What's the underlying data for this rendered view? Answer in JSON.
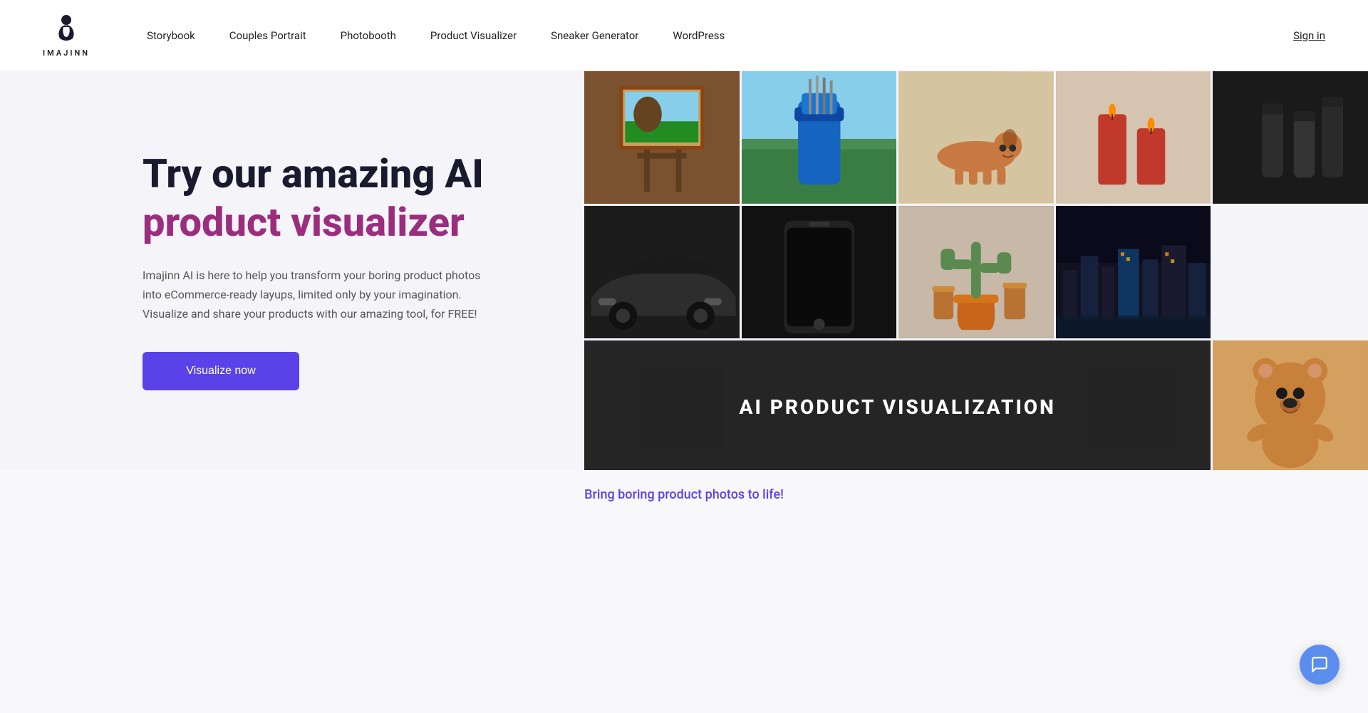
{
  "header": {
    "logo_text": "IMAJINN",
    "nav_items": [
      {
        "label": "Storybook",
        "id": "storybook"
      },
      {
        "label": "Couples Portrait",
        "id": "couples-portrait"
      },
      {
        "label": "Photobooth",
        "id": "photobooth"
      },
      {
        "label": "Product Visualizer",
        "id": "product-visualizer"
      },
      {
        "label": "Sneaker Generator",
        "id": "sneaker-generator"
      },
      {
        "label": "WordPress",
        "id": "wordpress"
      }
    ],
    "sign_in": "Sign in"
  },
  "hero": {
    "title_line1": "Try our amazing AI",
    "title_line2": "product visualizer",
    "description": "Imajinn AI is here to help you transform your boring product photos into eCommerce-ready layups, limited only by your imagination. Visualize and share your products with our amazing tool, for FREE!",
    "cta_label": "Visualize now",
    "banner_text": "AI PRODUCT VISUALIZATION"
  },
  "bottom": {
    "teaser_text": "Bring boring product photos to life!"
  },
  "chat": {
    "label": "chat-bubble"
  }
}
